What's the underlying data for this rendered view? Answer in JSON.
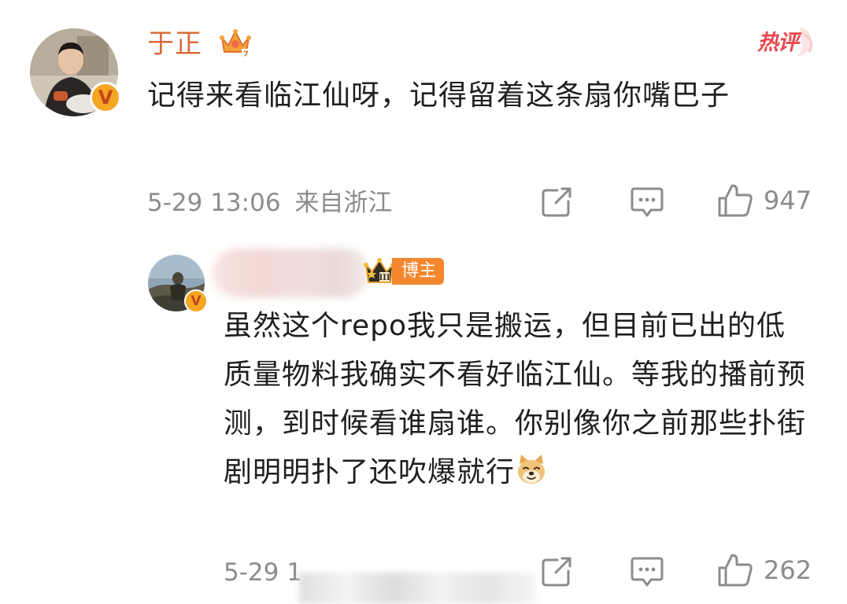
{
  "main_comment": {
    "username": "于正",
    "hot_label": "热评",
    "text": "记得来看临江仙呀，记得留着这条扇你嘴巴子",
    "date_time": "5-29 13:06",
    "location": "来自浙江",
    "like_count": "947"
  },
  "reply": {
    "username": "",
    "role_badge": "博主",
    "text": "虽然这个repo我只是搬运，但目前已出的低质量物料我确实不看好临江仙。等我的播前预测，到时候看谁扇谁。你别像你之前那些扑街剧明明扑了还吹爆就行",
    "date_time": "5-29 1",
    "like_count": "262"
  },
  "icons": {
    "verified": "verified-v-badge-icon",
    "crown": "crown-icon",
    "share": "share-icon",
    "comment": "comment-icon",
    "like": "thumbs-up-icon",
    "emoji": "doge-emoji-icon"
  },
  "colors": {
    "username": "#d96b3b",
    "hot_label": "#e8484e",
    "meta_text": "#8c8c8c",
    "body_text": "#1f1f1f",
    "blogger_badge": "#f4872e",
    "verified_badge": "#f6a623"
  }
}
